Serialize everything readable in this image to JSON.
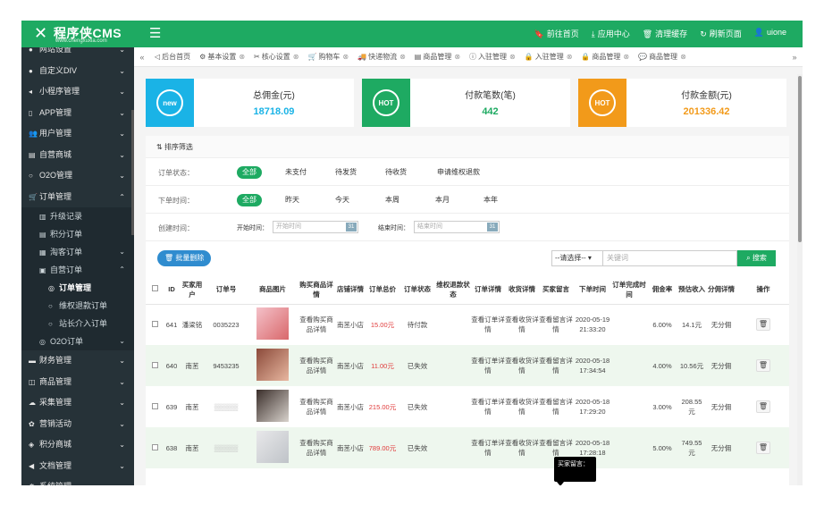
{
  "brand": {
    "name": "程序侠CMS",
    "url": "www.chengxuxia.com",
    "color": "#1eaa62"
  },
  "topbar": {
    "links": [
      {
        "icon": "bookmark-icon",
        "glyph": "🔖",
        "label": "前往首页"
      },
      {
        "icon": "download-icon",
        "glyph": "⤓",
        "label": "应用中心"
      },
      {
        "icon": "trash-icon",
        "glyph": "🗑",
        "label": "清理缓存"
      },
      {
        "icon": "refresh-icon",
        "glyph": "↻",
        "label": "刷新页面"
      },
      {
        "icon": "user-icon",
        "glyph": "👤",
        "label": "uione"
      }
    ]
  },
  "sidebar": {
    "items": [
      {
        "label": "网站设置",
        "icon": "dot-icon",
        "glyph": "●",
        "arrow": "⌄"
      },
      {
        "label": "自定义DIV",
        "icon": "dot-icon",
        "glyph": "●",
        "arrow": "⌄"
      },
      {
        "label": "小程序管理",
        "icon": "send-icon",
        "glyph": "◂",
        "arrow": "⌄"
      },
      {
        "label": "APP管理",
        "icon": "mobile-icon",
        "glyph": "▯",
        "arrow": "⌄"
      },
      {
        "label": "用户管理",
        "icon": "users-icon",
        "glyph": "👥",
        "arrow": "⌄"
      },
      {
        "label": "自营商城",
        "icon": "shop-icon",
        "glyph": "▤",
        "arrow": "⌄"
      },
      {
        "label": "O2O管理",
        "icon": "circle-icon",
        "glyph": "○",
        "arrow": "⌄"
      },
      {
        "label": "订单管理",
        "icon": "cart-icon",
        "glyph": "🛒",
        "arrow": "⌃"
      }
    ],
    "sub": [
      {
        "label": "升级记录",
        "icon": "chart-icon",
        "glyph": "▥",
        "level": 2
      },
      {
        "label": "积分订单",
        "icon": "doc-icon",
        "glyph": "▤",
        "level": 2
      },
      {
        "label": "淘客订单",
        "icon": "grid-icon",
        "glyph": "▦",
        "level": 2,
        "arrow": "⌄"
      },
      {
        "label": "自营订单",
        "icon": "box-icon",
        "glyph": "▣",
        "level": 2,
        "arrow": "⌃"
      },
      {
        "label": "订单管理",
        "icon": "o-icon",
        "glyph": "◎",
        "level": 3,
        "active": true
      },
      {
        "label": "维权退款订单",
        "icon": "circle-icon",
        "glyph": "○",
        "level": 3
      },
      {
        "label": "站长介入订单",
        "icon": "circle-icon",
        "glyph": "○",
        "level": 3
      },
      {
        "label": "O2O订单",
        "icon": "o-icon",
        "glyph": "◎",
        "level": 2,
        "arrow": "⌄"
      }
    ],
    "after": [
      {
        "label": "财务管理",
        "icon": "wallet-icon",
        "glyph": "▬",
        "arrow": "⌄"
      },
      {
        "label": "商品管理",
        "icon": "bag-icon",
        "glyph": "◫",
        "arrow": "⌄"
      },
      {
        "label": "采集管理",
        "icon": "cloud-icon",
        "glyph": "☁",
        "arrow": "⌄"
      },
      {
        "label": "营销活动",
        "icon": "gift-icon",
        "glyph": "✿",
        "arrow": "⌄"
      },
      {
        "label": "积分商城",
        "icon": "store-icon",
        "glyph": "◈",
        "arrow": "⌄"
      },
      {
        "label": "文档管理",
        "icon": "speaker-icon",
        "glyph": "◀",
        "arrow": "⌄"
      },
      {
        "label": "系统管理",
        "icon": "gear-icon",
        "glyph": "⚙",
        "arrow": "⌄"
      }
    ]
  },
  "tabs": [
    {
      "label": "后台首页",
      "glyph": "◁"
    },
    {
      "label": "基本设置",
      "glyph": "⚙",
      "close": "⊗"
    },
    {
      "label": "核心设置",
      "glyph": "✂",
      "close": "⊗"
    },
    {
      "label": "购物车",
      "glyph": "🛒",
      "close": "⊗"
    },
    {
      "label": "快递物流",
      "glyph": "🚚",
      "close": "⊗"
    },
    {
      "label": "商品管理",
      "glyph": "▤",
      "close": "⊗"
    },
    {
      "label": "入驻管理",
      "glyph": "ⓘ",
      "close": "⊗"
    },
    {
      "label": "入驻管理",
      "glyph": "🔒",
      "close": "⊗"
    },
    {
      "label": "商品管理",
      "glyph": "🔒",
      "close": "⊗"
    },
    {
      "label": "商品管理",
      "glyph": "💬",
      "close": "⊗"
    }
  ],
  "stats": [
    {
      "label": "总佣金(元)",
      "value": "18718.09",
      "badge": "new",
      "bg": "#1ab3e6",
      "color": "#1ab3e6"
    },
    {
      "label": "付款笔数(笔)",
      "value": "442",
      "badge": "HOT",
      "bg": "#1eaa62",
      "color": "#1eaa62"
    },
    {
      "label": "付款金额(元)",
      "value": "201336.42",
      "badge": "HOT",
      "bg": "#f29a1a",
      "color": "#f29a1a"
    }
  ],
  "filters": {
    "title": "排序筛选",
    "status_label": "订单状态：",
    "status_options": [
      "全部",
      "未支付",
      "待发货",
      "待收货",
      "申请维权退款"
    ],
    "time_label": "下单时间：",
    "time_options": [
      "全部",
      "昨天",
      "今天",
      "本周",
      "本月",
      "本年"
    ],
    "created_label": "创建时间：",
    "start_label": "开始时间：",
    "start_placeholder": "开始时间",
    "end_label": "结束时间：",
    "end_placeholder": "结束时间"
  },
  "toolbar": {
    "bulk_delete": "批量删除",
    "select_value": "--请选择--",
    "keyword_placeholder": "关键词",
    "search": "搜索"
  },
  "table": {
    "headers": [
      "",
      "ID",
      "买家用户",
      "订单号",
      "商品图片",
      "购买商品详情",
      "店铺详情",
      "订单总价",
      "订单状态",
      "维权退款状态",
      "订单详情",
      "收货详情",
      "买家留言",
      "下单时间",
      "订单完成时间",
      "佣金率",
      "预估收入",
      "分佣详情",
      "操作"
    ],
    "rows": [
      {
        "id": "641",
        "user": "潘梁铭",
        "order": "0035223",
        "img": [
          "#f4c1c9",
          "#d9686b"
        ],
        "goods": "查看购买商品详情",
        "shop": "南苤小店",
        "total": "15.00元",
        "status": "待付款",
        "refund": "",
        "detail": "查看订单详情",
        "ship": "查看收货详情",
        "msg": "查看留言详情",
        "time": "2020-05-19 21:33:20",
        "done": "",
        "rate": "6.00%",
        "income": "14.1元",
        "split": "无分佣"
      },
      {
        "id": "640",
        "user": "南苤",
        "order": "9453235",
        "img": [
          "#8b4a3a",
          "#e8b7a0"
        ],
        "goods": "查看购买商品详情",
        "shop": "南苤小店",
        "total": "11.00元",
        "status": "已失效",
        "refund": "",
        "detail": "查看订单详情",
        "ship": "查看收货详情",
        "msg": "查看留言详情",
        "time": "2020-05-18 17:34:54",
        "done": "",
        "rate": "4.00%",
        "income": "10.56元",
        "split": "无分佣"
      },
      {
        "id": "639",
        "user": "南苤",
        "order": "",
        "img": [
          "#3a2e2a",
          "#d8d2cc"
        ],
        "goods": "查看购买商品详情",
        "shop": "南苤小店",
        "total": "215.00元",
        "status": "已失效",
        "refund": "",
        "detail": "查看订单详情",
        "ship": "查看收货详情",
        "msg": "查看留言详情",
        "time": "2020-05-18 17:29:20",
        "done": "",
        "rate": "3.00%",
        "income": "208.55元",
        "split": "无分佣"
      },
      {
        "id": "638",
        "user": "南苤",
        "order": "",
        "img": [
          "#e8e8ea",
          "#bfc3c8"
        ],
        "goods": "查看购买商品详情",
        "shop": "南苤小店",
        "total": "789.00元",
        "status": "已失效",
        "refund": "",
        "detail": "查看订单详情",
        "ship": "查看收货详情",
        "msg": "查看留言详情",
        "time": "2020-05-18 17:28:18",
        "done": "",
        "rate": "5.00%",
        "income": "749.55元",
        "split": "无分佣"
      }
    ]
  },
  "tooltip": "买家留言："
}
